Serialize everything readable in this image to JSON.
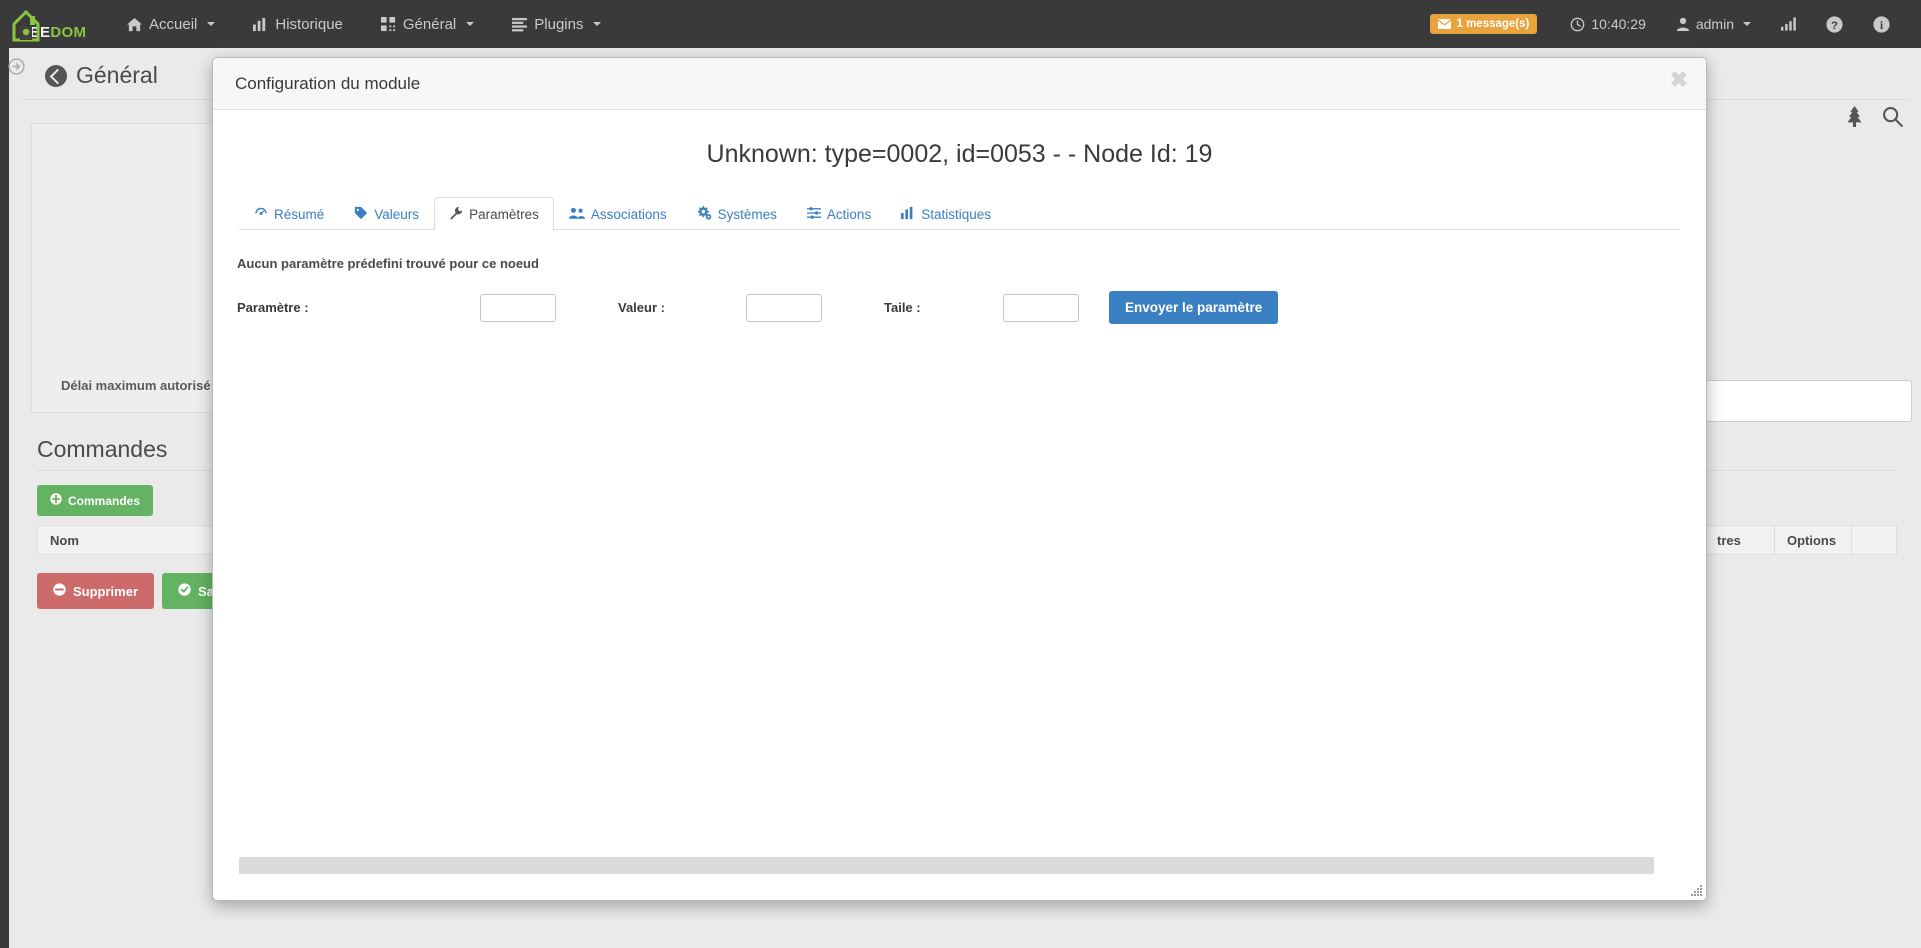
{
  "navbar": {
    "brand": {
      "white": "EE",
      "green": "DOM"
    },
    "items": [
      {
        "label": "Accueil",
        "icon": "home-icon",
        "caret": true
      },
      {
        "label": "Historique",
        "icon": "bar-chart-icon",
        "caret": false
      },
      {
        "label": "Général",
        "icon": "grid-icon",
        "caret": true
      },
      {
        "label": "Plugins",
        "icon": "list-icon",
        "caret": true
      }
    ],
    "message_badge": {
      "label": "1 message(s)",
      "icon": "envelope-icon",
      "color": "#e8a33d"
    },
    "clock": {
      "label": "10:40:29",
      "icon": "clock-icon"
    },
    "user": {
      "label": "admin",
      "icon": "user-icon",
      "caret": true
    },
    "signal_icon": "signal-bars-icon",
    "help_icon": "question-circle-icon",
    "info_icon": "info-circle-icon"
  },
  "page": {
    "title": "Général",
    "back_icon": "back-arrow-circle-icon",
    "rail_toggle_icon": "arrow-circle-right-icon",
    "header_icons": [
      "tree-icon",
      "search-icon"
    ],
    "delay_label": "Délai maximum autorisé",
    "commands_title": "Commandes",
    "add_command_button": "Commandes",
    "add_command_icon": "plus-circle-icon",
    "table_headers": [
      "Nom",
      "tres",
      "Options"
    ],
    "delete_button": "Supprimer",
    "delete_icon": "minus-circle-icon",
    "save_button": "Sauve",
    "save_icon": "check-circle-icon"
  },
  "modal": {
    "header_title": "Configuration du module",
    "close_icon": "close-icon",
    "module_title": "Unknown: type=0002, id=0053 - - Node Id: 19",
    "tabs": [
      {
        "label": "Résumé",
        "icon": "dashboard-icon",
        "active": false
      },
      {
        "label": "Valeurs",
        "icon": "tag-icon",
        "active": false
      },
      {
        "label": "Paramètres",
        "icon": "wrench-icon",
        "active": true
      },
      {
        "label": "Associations",
        "icon": "users-icon",
        "active": false
      },
      {
        "label": "Systèmes",
        "icon": "gears-icon",
        "active": false
      },
      {
        "label": "Actions",
        "icon": "sliders-icon",
        "active": false
      },
      {
        "label": "Statistiques",
        "icon": "bar-chart-icon",
        "active": false
      }
    ],
    "form": {
      "note": "Aucun paramètre prédefini trouvé pour ce noeud",
      "param_label": "Paramètre :",
      "param_value": "",
      "value_label": "Valeur :",
      "value_value": "",
      "size_label": "Taile :",
      "size_value": "",
      "submit_label": "Envoyer le paramètre"
    },
    "scrollbar_name": "horizontal-scrollbar",
    "resize_icon": "resize-grip-icon"
  },
  "colors": {
    "navbar_bg": "#3a3a3a",
    "brand_green": "#8bc53f",
    "accent_blue": "#3a7fc1",
    "badge_orange": "#e8a33d",
    "green": "#63b363",
    "red": "#cd6a6a"
  }
}
